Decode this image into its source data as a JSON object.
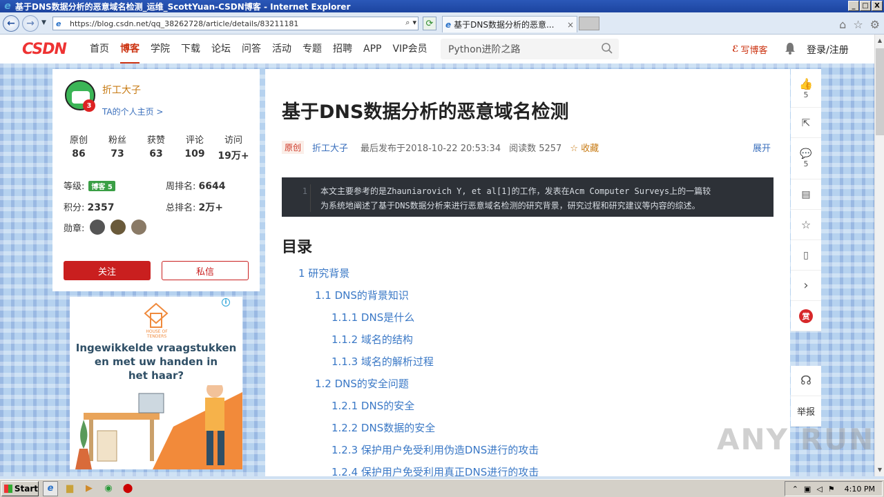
{
  "browser": {
    "window_title": "基于DNS数据分析的恶意域名检测_运维_ScottYuan-CSDN博客 - Internet Explorer",
    "url": "https://blog.csdn.net/qq_38262728/article/details/83211181",
    "tab_title": "基于DNS数据分析的恶意...",
    "window_buttons": [
      "_",
      "□",
      "X"
    ]
  },
  "csdn": {
    "logo": "CSDN",
    "menu": [
      "首页",
      "博客",
      "学院",
      "下载",
      "论坛",
      "问答",
      "活动",
      "专题",
      "招聘",
      "APP",
      "VIP会员"
    ],
    "active_menu": "博客",
    "search_value": "Python进阶之路",
    "write_blog": "写博客",
    "login": "登录/注册"
  },
  "profile": {
    "name": "折工大子",
    "home_link": "TA的个人主页 >",
    "avatar_badge": "3",
    "stats": [
      {
        "label": "原创",
        "value": "86"
      },
      {
        "label": "粉丝",
        "value": "73"
      },
      {
        "label": "获赞",
        "value": "63"
      },
      {
        "label": "评论",
        "value": "109"
      },
      {
        "label": "访问",
        "value": "19万+"
      }
    ],
    "level_label": "等级:",
    "level_tag": "博客 5",
    "week_rank_label": "周排名:",
    "week_rank": "6644",
    "points_label": "积分:",
    "points": "2357",
    "total_rank_label": "总排名:",
    "total_rank": "2万+",
    "medals_label": "勋章:",
    "follow": "关注",
    "message": "私信"
  },
  "ad": {
    "brand": "HOUSE OF TENDERS",
    "headline_1": "Ingewikkelde vraagstukken",
    "headline_2": "en met uw handen in",
    "headline_3": "het haar?",
    "info_icon": "i"
  },
  "article": {
    "title": "基于DNS数据分析的恶意域名检测",
    "tag": "原创",
    "author": "折工大子",
    "date": "最后发布于2018-10-22 20:53:34",
    "reads": "阅读数 5257",
    "favorite": "☆ 收藏",
    "expand": "展开",
    "code_line_no": "1",
    "code_line_1": "本文主要参考的是Zhauniarovich Y, et al[1]的工作，发表在Acm Computer Surveys上的一篇较",
    "code_line_2": "为系统地阐述了基于DNS数据分析来进行恶意域名检测的研究背景，研究过程和研究建议等内容的综述。",
    "toc_title": "目录",
    "toc": [
      "1 研究背景",
      "1.1 DNS的背景知识",
      "1.1.1 DNS是什么",
      "1.1.2 域名的结构",
      "1.1.3 域名的解析过程",
      "1.2 DNS的安全问题",
      "1.2.1 DNS的安全",
      "1.2.2 DNS数据的安全",
      "1.2.3 保护用户免受利用伪造DNS进行的攻击",
      "1.2.4 保护用户免受利用真正DNS进行的攻击"
    ]
  },
  "sidebar": {
    "like_count": "5",
    "comment_count": "5",
    "reward": "赏",
    "report": "举报"
  },
  "watermark": "ANY RUN",
  "taskbar": {
    "start": "Start",
    "clock": "4:10 PM"
  }
}
